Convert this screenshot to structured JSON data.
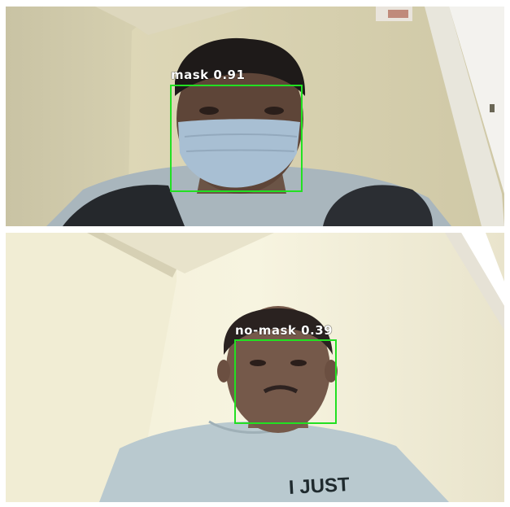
{
  "detections": [
    {
      "label": "mask 0.91",
      "class": "mask",
      "confidence": 0.91
    },
    {
      "label": "no-mask 0.39",
      "class": "no-mask",
      "confidence": 0.39
    }
  ],
  "colors": {
    "box": "#22e022",
    "label_text": "#ffffff",
    "wall": "#cfc8a6",
    "shirt": "#b7c6cc"
  },
  "shirt_text": "I JUST"
}
